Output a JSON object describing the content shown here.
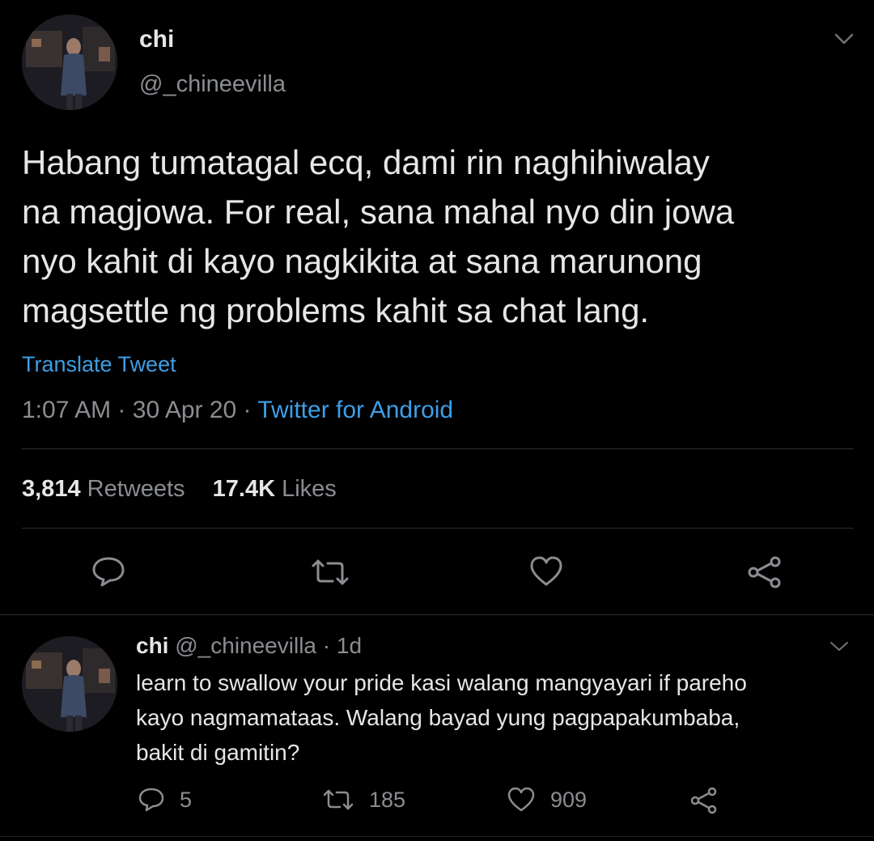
{
  "main_tweet": {
    "name": "chi",
    "handle": "@_chineevilla",
    "text_lines": [
      "Habang tumatagal ecq, dami rin naghihiwalay",
      "na magjowa. For real, sana mahal nyo din jowa",
      "nyo kahit di kayo nagkikita at sana marunong",
      "magsettle ng problems kahit sa chat lang."
    ],
    "translate_label": "Translate Tweet",
    "time": "1:07 AM",
    "separator": "·",
    "date": "30 Apr 20",
    "source": "Twitter for Android",
    "retweets_count": "3,814",
    "retweets_label": "Retweets",
    "likes_count": "17.4K",
    "likes_label": "Likes"
  },
  "reply_tweet": {
    "name": "chi",
    "handle": "@_chineevilla",
    "separator": "·",
    "age": "1d",
    "text_lines": [
      "learn to swallow your pride kasi walang mangyayari if pareho",
      "kayo nagmamataas. Walang bayad yung pagpapakumbaba,",
      "bakit di gamitin?"
    ],
    "reply_count": "5",
    "retweet_count": "185",
    "like_count": "909"
  },
  "icons": {
    "more": "chevron-down-icon",
    "reply": "comment-icon",
    "retweet": "retweet-icon",
    "like": "heart-icon",
    "share": "share-icon"
  },
  "colors": {
    "background": "#000000",
    "text": "#e6e6e6",
    "muted": "#8a8d91",
    "link": "#3e9ee6",
    "divider": "#2b2f33"
  }
}
